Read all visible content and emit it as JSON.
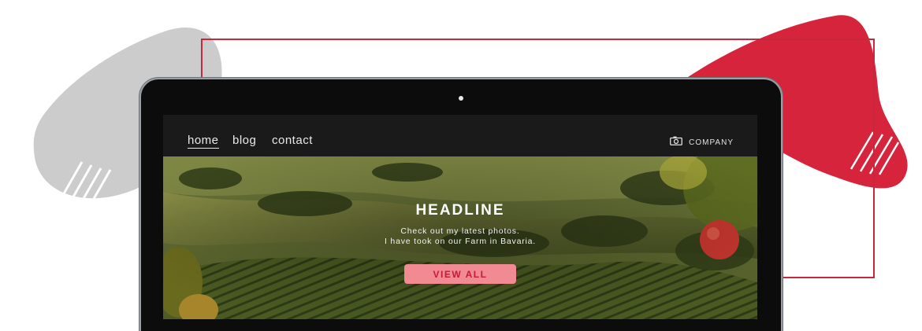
{
  "nav": {
    "items": [
      {
        "label": "home",
        "active": true
      },
      {
        "label": "blog",
        "active": false
      },
      {
        "label": "contact",
        "active": false
      }
    ],
    "brand_icon": "camera-icon",
    "brand_label": "COMPANY"
  },
  "hero": {
    "headline": "HEADLINE",
    "subtext_line1": "Check out my latest photos.",
    "subtext_line2": "I have took on our Farm in Bavaria.",
    "button_label": "VIEW ALL",
    "image": "vineyard-landscape-photo"
  },
  "colors": {
    "accent_red": "#d6243d",
    "blob_gray": "#cccccc",
    "button_pink": "#f28a93",
    "button_text": "#c21d36",
    "navbar_bg": "#1a1a1a"
  }
}
